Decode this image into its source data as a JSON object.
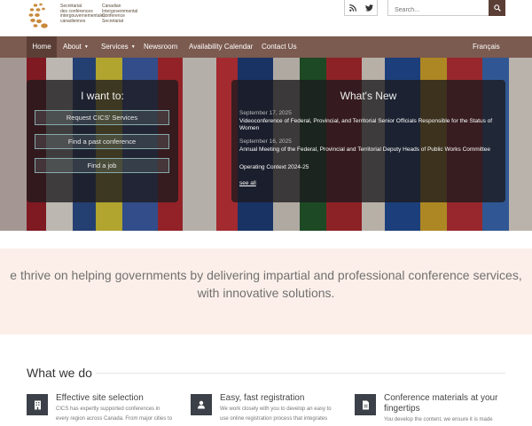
{
  "header": {
    "logo_fr": [
      "Secrétariat",
      "des conférences",
      "intergouvernementales",
      "canadiennes"
    ],
    "logo_en": [
      "Canadian",
      "Intergovernmental",
      "Conference",
      "Secretariat"
    ],
    "social": [
      "rss-icon",
      "twitter-icon"
    ],
    "search_placeholder": "Search..."
  },
  "nav": {
    "items": [
      {
        "label": "Home",
        "active": true
      },
      {
        "label": "About",
        "caret": true
      },
      {
        "label": "Services",
        "caret": true
      },
      {
        "label": "Newsroom"
      },
      {
        "label": "Availability Calendar"
      },
      {
        "label": "Contact Us"
      }
    ],
    "language": "Français",
    "caret_glyph": "▼"
  },
  "hero": {
    "want": {
      "title": "I want to:",
      "buttons": [
        "Request CICS' Services",
        "Find a past conference",
        "Find a job"
      ]
    },
    "news": {
      "title": "What's New",
      "items": [
        {
          "date": "September 17, 2025",
          "text": "Videoconference of Federal, Provincial, and Territorial Senior Officials Responsible for the Status of Women"
        },
        {
          "date": "September 16, 2025",
          "text": "Annual Meeting of the Federal, Provincial and Territorial Deputy Heads of Public Works Committee"
        },
        {
          "date": "",
          "text": "Operating Context 2024-25"
        }
      ],
      "see_all": "see all"
    }
  },
  "mission": {
    "line1": "e thrive on helping governments by delivering impartial and professional conference services,",
    "line2": "with innovative solutions."
  },
  "whatwedo": {
    "title": "What we do",
    "features": [
      {
        "icon": "building-icon",
        "title": "Effective site selection",
        "desc": [
          "CICS has expertly supported conferences in",
          "every region across Canada. From major cities to"
        ]
      },
      {
        "icon": "user-icon",
        "title": "Easy, fast registration",
        "desc": [
          "We work closely with you to develop an easy to",
          "use online registration process that integrates"
        ]
      },
      {
        "icon": "document-icon",
        "title": "Conference materials at your fingertips",
        "desc": [
          "You develop the content, we ensure it is made"
        ]
      }
    ]
  },
  "colors": {
    "nav": "#7b5a4f",
    "nav_active": "#5b3f36",
    "mission_bg": "#fcefe9",
    "icon_bg": "#3c4048"
  }
}
